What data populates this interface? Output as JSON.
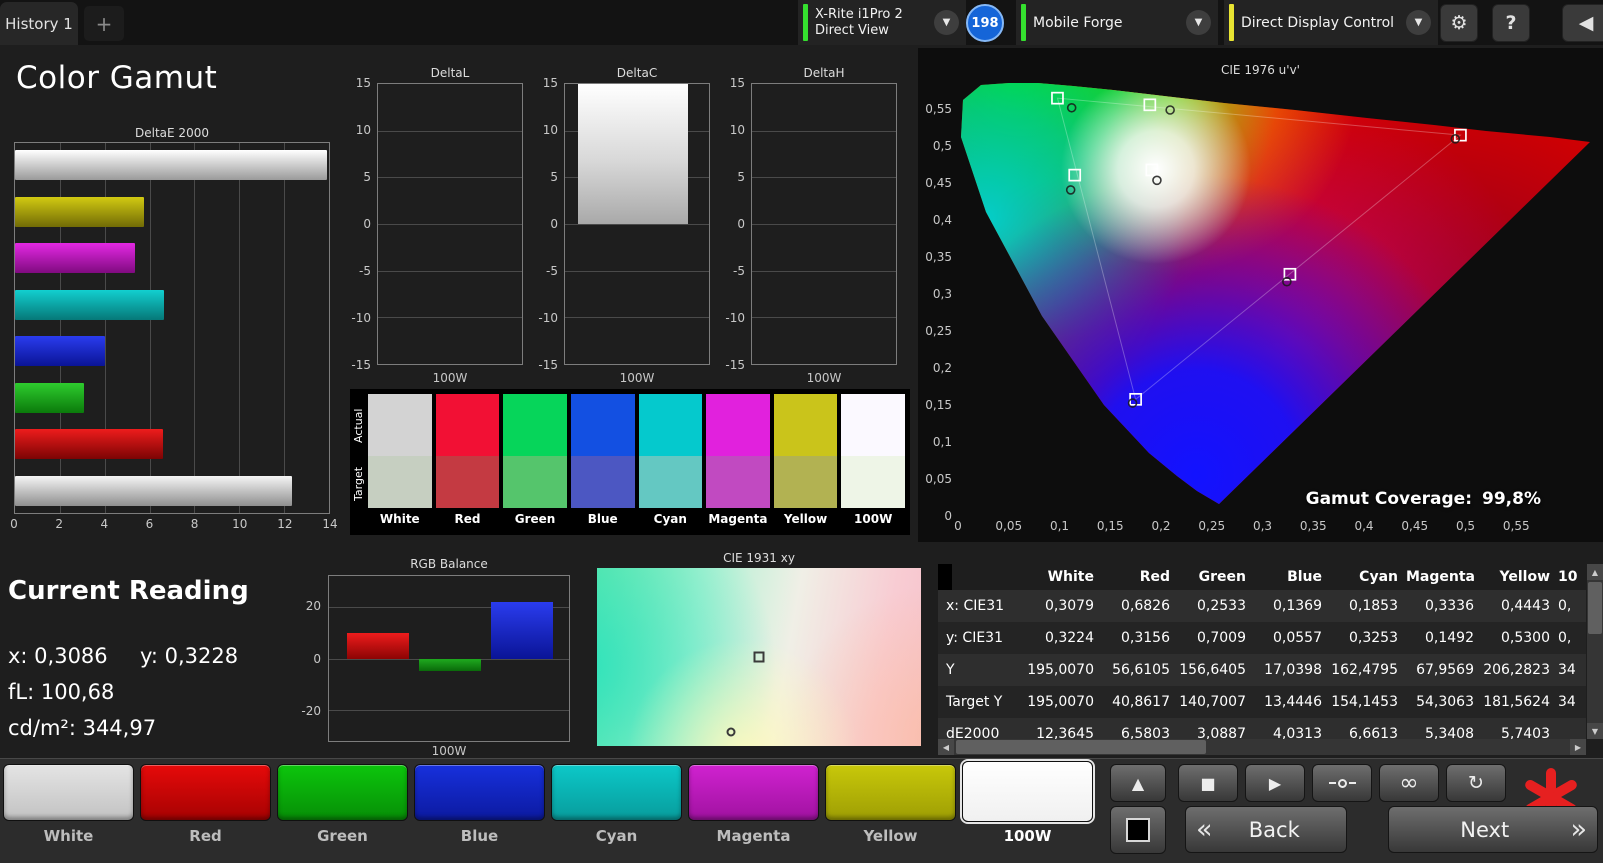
{
  "colors": {
    "logo_red": "#e62020",
    "badge_blue": "#1565d8"
  },
  "icons": {
    "dropdown": "▼",
    "gear": "⚙",
    "collapse": "◀",
    "up": "▲",
    "stop": "■",
    "play": "▶",
    "infinity": "∞",
    "loop": "↻",
    "scroll_up": "▲",
    "scroll_down": "▼",
    "scroll_left": "◀",
    "scroll_right": "▶"
  },
  "top_bar": {
    "history_tab": "History 1",
    "add_tab_label": "+",
    "meter": {
      "line1": "X-Rite i1Pro 2",
      "line2": "Direct View"
    },
    "badge_count": "198",
    "source_label": "Mobile Forge",
    "display_control_label": "Direct Display Control",
    "help_label": "?",
    "colors": {
      "meter_indicator": "#35e02f",
      "source_indicator": "#35e02f",
      "display_indicator": "#e8e432"
    }
  },
  "page_title": "Color Gamut",
  "current_reading": {
    "title": "Current Reading",
    "x": "x: 0,3086",
    "y": "y: 0,3228",
    "fl": "fL: 100,68",
    "cdm2": "cd/m²: 344,97"
  },
  "swatch_strip": {
    "row_labels": [
      "Actual",
      "Target"
    ],
    "columns": [
      {
        "label": "White",
        "actual": "#d3d3d3",
        "target": "#c6cfc1"
      },
      {
        "label": "Red",
        "actual": "#f21034",
        "target": "#c43a42"
      },
      {
        "label": "Green",
        "actual": "#06d55a",
        "target": "#55c56c"
      },
      {
        "label": "Blue",
        "actual": "#1350e2",
        "target": "#4c57c2"
      },
      {
        "label": "Cyan",
        "actual": "#05c9cd",
        "target": "#64c8c2"
      },
      {
        "label": "Magenta",
        "actual": "#e121dd",
        "target": "#c14ac1"
      },
      {
        "label": "Yellow",
        "actual": "#cac41b",
        "target": "#b2b252"
      },
      {
        "label": "100W",
        "actual": "#fbf9ff",
        "target": "#eef5e7"
      }
    ]
  },
  "chart_data": [
    {
      "id": "deltaE2000",
      "type": "bar",
      "orientation": "horizontal",
      "title": "DeltaE 2000",
      "categories": [
        "White",
        "Red",
        "Green",
        "Blue",
        "Cyan",
        "Magenta",
        "Yellow",
        "100W"
      ],
      "values": [
        12.36,
        6.58,
        3.09,
        4.03,
        6.66,
        5.34,
        5.74,
        13.9
      ],
      "display_top_to_bottom": [
        "100W",
        "Yellow",
        "Magenta",
        "Cyan",
        "Blue",
        "Green",
        "Red",
        "White"
      ],
      "xlim": [
        0,
        14
      ],
      "xticks": [
        0,
        2,
        4,
        6,
        8,
        10,
        12,
        14
      ],
      "bar_colors": {
        "White": [
          "#f5f5f5",
          "#8f8f8f"
        ],
        "Red": [
          "#ee1c1c",
          "#7c0404"
        ],
        "Green": [
          "#2ecc2e",
          "#0b7a0b"
        ],
        "Blue": [
          "#2a3cee",
          "#0a1496"
        ],
        "Cyan": [
          "#12cfcf",
          "#067878"
        ],
        "Magenta": [
          "#e428e4",
          "#800b80"
        ],
        "Yellow": [
          "#d2ca12",
          "#716b06"
        ],
        "100W": [
          "#ffffff",
          "#9a9a9a"
        ]
      }
    },
    {
      "id": "deltaL",
      "type": "bar",
      "title": "DeltaL",
      "categories": [
        "100W"
      ],
      "values": [
        0
      ],
      "ylim": [
        -15,
        15
      ],
      "yticks": [
        15,
        10,
        5,
        0,
        -5,
        -10,
        -15
      ]
    },
    {
      "id": "deltaC",
      "type": "bar",
      "title": "DeltaC",
      "categories": [
        "100W"
      ],
      "values": [
        15.6
      ],
      "ylim": [
        -15,
        15
      ],
      "yticks": [
        15,
        10,
        5,
        0,
        -5,
        -10,
        -15
      ]
    },
    {
      "id": "deltaH",
      "type": "bar",
      "title": "DeltaH",
      "categories": [
        "100W"
      ],
      "values": [
        0
      ],
      "ylim": [
        -15,
        15
      ],
      "yticks": [
        15,
        10,
        5,
        0,
        -5,
        -10,
        -15
      ]
    },
    {
      "id": "rgb_balance",
      "type": "bar",
      "title": "RGB Balance",
      "categories": [
        "Red",
        "Green",
        "Blue"
      ],
      "values": [
        10,
        -5,
        22
      ],
      "ylim": [
        -32,
        32
      ],
      "yticks": [
        20,
        0,
        -20
      ],
      "xlabel": "100W",
      "bar_colors": {
        "Red": [
          "#ee1c1c",
          "#8c0404"
        ],
        "Green": [
          "#1faa1f",
          "#0a6a0a"
        ],
        "Blue": [
          "#2a3cee",
          "#0a1496"
        ]
      }
    },
    {
      "id": "cie1976",
      "type": "scatter",
      "title": "CIE 1976 u'v'",
      "xlim": [
        0,
        0.635
      ],
      "ylim": [
        0,
        0.625
      ],
      "xticks": [
        "0",
        "0,05",
        "0,1",
        "0,15",
        "0,2",
        "0,25",
        "0,3",
        "0,35",
        "0,4",
        "0,45",
        "0,5",
        "0,55"
      ],
      "yticks": [
        "0",
        "0,05",
        "0,1",
        "0,15",
        "0,2",
        "0,25",
        "0,3",
        "0,35",
        "0,4",
        "0,45",
        "0,5",
        "0,55"
      ],
      "coverage_label": "Gamut Coverage:",
      "coverage_value": "99,8%",
      "points": [
        {
          "name": "white",
          "target": [
            0.191,
            0.469
          ],
          "measured": [
            0.196,
            0.455
          ]
        },
        {
          "name": "red",
          "target": [
            0.495,
            0.516
          ],
          "measured": [
            0.49,
            0.511
          ]
        },
        {
          "name": "green",
          "target": [
            0.098,
            0.566
          ],
          "measured": [
            0.112,
            0.553
          ]
        },
        {
          "name": "yellow",
          "target": [
            0.189,
            0.557
          ],
          "measured": [
            0.209,
            0.55
          ]
        },
        {
          "name": "cyan",
          "target": [
            0.115,
            0.462
          ],
          "measured": [
            0.111,
            0.442
          ]
        },
        {
          "name": "magenta",
          "target": [
            0.327,
            0.328
          ],
          "measured": [
            0.324,
            0.318
          ]
        },
        {
          "name": "blue",
          "target": [
            0.175,
            0.159
          ],
          "measured": [
            0.172,
            0.154
          ]
        }
      ]
    },
    {
      "id": "cie1931",
      "type": "scatter",
      "title": "CIE 1931 xy",
      "markers": [
        {
          "shape": "square",
          "pos": [
            0.5,
            0.5
          ]
        },
        {
          "shape": "circle",
          "pos": [
            0.415,
            0.92
          ]
        }
      ]
    }
  ],
  "table": {
    "headers": [
      "",
      "White",
      "Red",
      "Green",
      "Blue",
      "Cyan",
      "Magenta",
      "Yellow",
      "10"
    ],
    "rows": [
      {
        "label": "x: CIE31",
        "values": [
          "0,3079",
          "0,6826",
          "0,2533",
          "0,1369",
          "0,1853",
          "0,3336",
          "0,4443",
          "0,"
        ]
      },
      {
        "label": "y: CIE31",
        "values": [
          "0,3224",
          "0,3156",
          "0,7009",
          "0,0557",
          "0,3253",
          "0,1492",
          "0,5300",
          "0,"
        ]
      },
      {
        "label": "Y",
        "values": [
          "195,0070",
          "56,6105",
          "156,6405",
          "17,0398",
          "162,4795",
          "67,9569",
          "206,2823",
          "34"
        ]
      },
      {
        "label": "Target Y",
        "values": [
          "195,0070",
          "40,8617",
          "140,7007",
          "13,4446",
          "154,1453",
          "54,3063",
          "181,5624",
          "34"
        ]
      },
      {
        "label": "dE2000",
        "values": [
          "12,3645",
          "6,5803",
          "3,0887",
          "4,0313",
          "6,6613",
          "5,3408",
          "5,7403",
          ""
        ]
      }
    ]
  },
  "pattern_bar": {
    "buttons": [
      {
        "label": "White",
        "color_top": "#e4e4e4",
        "color_bottom": "#c2c2c2",
        "selected": false
      },
      {
        "label": "Red",
        "color_top": "#e60a0a",
        "color_bottom": "#a60202",
        "selected": false
      },
      {
        "label": "Green",
        "color_top": "#0cc60c",
        "color_bottom": "#078e07",
        "selected": false
      },
      {
        "label": "Blue",
        "color_top": "#1730dc",
        "color_bottom": "#0c1aa0",
        "selected": false
      },
      {
        "label": "Cyan",
        "color_top": "#0cc8c8",
        "color_bottom": "#089c9c",
        "selected": false
      },
      {
        "label": "Magenta",
        "color_top": "#d022d0",
        "color_bottom": "#a012a0",
        "selected": false
      },
      {
        "label": "Yellow",
        "color_top": "#c8c80a",
        "color_bottom": "#9e9e04",
        "selected": false
      },
      {
        "label": "100W",
        "color_top": "#ffffff",
        "color_bottom": "#f0f0f0",
        "selected": true
      }
    ]
  },
  "nav": {
    "back_label": "Back",
    "next_label": "Next",
    "back_chevron": "«",
    "next_chevron": "»"
  }
}
